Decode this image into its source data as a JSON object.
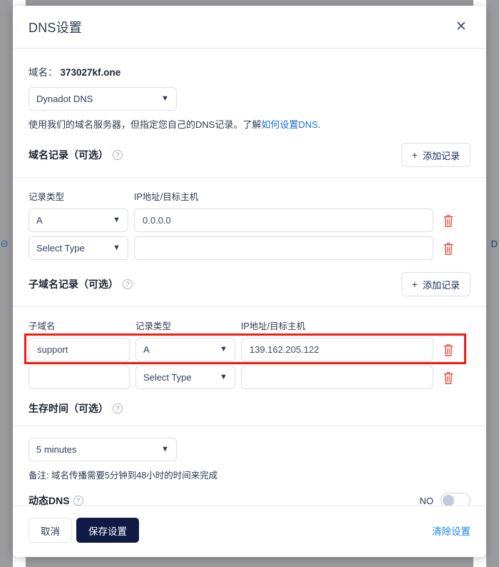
{
  "background": {
    "left_glyph": "Θ",
    "right_glyph": "D"
  },
  "modal": {
    "title": "DNS设置",
    "close_icon": "close-icon",
    "domain": {
      "label": "域名：",
      "value": "373027kf.one"
    },
    "nameserver_select": {
      "value": "Dynadot DNS",
      "chevron": "chevron-down-icon"
    },
    "description": {
      "text_before": "使用我们的域名服务器，但指定您自己的DNS记录。了解",
      "link_text": "如何设置DNS",
      "text_after": "."
    },
    "domain_records": {
      "title": "域名记录（可选）",
      "help_icon": "help-icon",
      "add_button": {
        "label": "添加记录",
        "icon": "plus-icon"
      },
      "columns": [
        "记录类型",
        "IP地址/目标主机"
      ],
      "rows": [
        {
          "type": "A",
          "value": "0.0.0.0",
          "value_placeholder": "",
          "delete_icon": "trash-icon"
        },
        {
          "type": "Select Type",
          "value": "",
          "value_placeholder": "",
          "delete_icon": "trash-icon"
        }
      ]
    },
    "subdomain_records": {
      "title": "子域名记录（可选）",
      "help_icon": "help-icon",
      "add_button": {
        "label": "添加记录",
        "icon": "plus-icon"
      },
      "columns": [
        "子域名",
        "记录类型",
        "IP地址/目标主机"
      ],
      "rows": [
        {
          "name": "support",
          "type": "A",
          "value": "139.162.205.122",
          "delete_icon": "trash-icon",
          "highlighted": true
        },
        {
          "name": "",
          "type": "Select Type",
          "value": "",
          "delete_icon": "trash-icon",
          "highlighted": false
        }
      ],
      "highlight_color": "#ef1d12"
    },
    "ttl": {
      "title": "生存时间（可选）",
      "help_icon": "help-icon",
      "select_value": "5 minutes",
      "note": "备注: 域名传播需要5分钟到48小时的时间来完成"
    },
    "dynamic_dns": {
      "label": "动态DNS",
      "help_icon": "help-icon",
      "state_label": "NO",
      "enabled": false
    },
    "footer": {
      "cancel_label": "取消",
      "save_label": "保存设置",
      "clear_label": "清除设置"
    },
    "colors": {
      "accent_navy": "#0f1b45",
      "link_blue": "#1a73c7",
      "clear_blue": "#2288e8",
      "danger_red": "#ef1d12",
      "trash_red": "#e8534a"
    }
  }
}
